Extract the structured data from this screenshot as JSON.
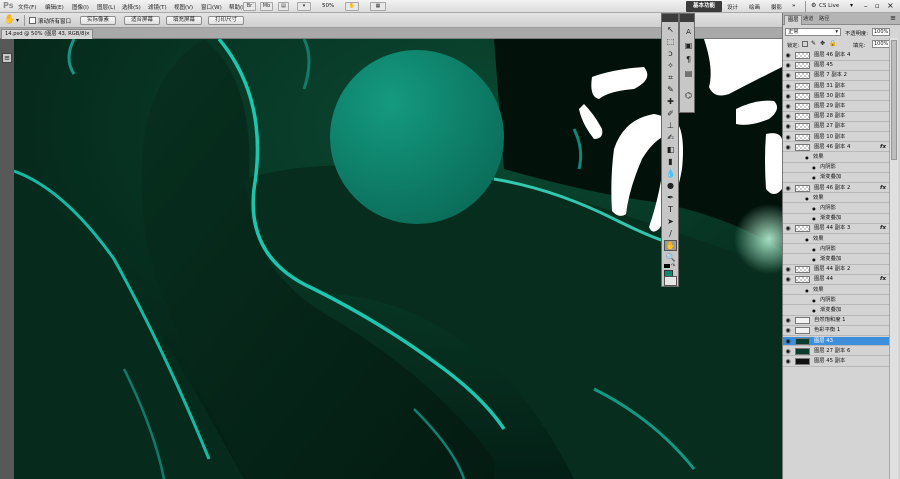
{
  "app": {
    "logo": "Ps",
    "menus": [
      "文件(F)",
      "编辑(E)",
      "图像(I)",
      "图层(L)",
      "选择(S)",
      "滤镜(T)",
      "视图(V)",
      "窗口(W)",
      "帮助(H)"
    ],
    "zoom": "50%",
    "workspaces": [
      "基本功能",
      "设计",
      "绘画",
      "摄影",
      "CS Live"
    ],
    "workspace_more": "»"
  },
  "options": {
    "checkbox_label": "滚动所有窗口",
    "buttons": [
      "实际像素",
      "适合屏幕",
      "填充屏幕",
      "打印尺寸"
    ]
  },
  "document": {
    "tab_title": "14.psd @ 50% (图层 43, RGB/8)"
  },
  "layers_panel": {
    "tabs": [
      "图层",
      "通道",
      "路径"
    ],
    "blend_mode": "正常",
    "opacity_label": "不透明度:",
    "opacity_value": "100%",
    "lock_label": "锁定:",
    "fill_label": "填充:",
    "fill_value": "100%",
    "layers": [
      {
        "name": "图层 46 副本 4",
        "thumb": "chk",
        "fx": false,
        "selected": false
      },
      {
        "name": "图层 45",
        "thumb": "chk",
        "fx": false,
        "selected": false
      },
      {
        "name": "图层 7 副本 2",
        "thumb": "chk",
        "fx": false,
        "selected": false
      },
      {
        "name": "图层 31 副本",
        "thumb": "chk",
        "fx": false,
        "selected": false
      },
      {
        "name": "图层 30 副本",
        "thumb": "chk",
        "fx": false,
        "selected": false
      },
      {
        "name": "图层 29 副本",
        "thumb": "chk",
        "fx": false,
        "selected": false
      },
      {
        "name": "图层 28 副本",
        "thumb": "chk",
        "fx": false,
        "selected": false
      },
      {
        "name": "图层 27 副本",
        "thumb": "chk",
        "fx": false,
        "selected": false
      },
      {
        "name": "图层 10 副本",
        "thumb": "chk",
        "fx": false,
        "selected": false
      },
      {
        "name": "图层 46 副本 4",
        "thumb": "chk",
        "fx": true,
        "selected": false
      },
      {
        "name": "效果",
        "sub": 1
      },
      {
        "name": "内阴影",
        "sub": 2
      },
      {
        "name": "渐变叠加",
        "sub": 2
      },
      {
        "name": "图层 46 副本 2",
        "thumb": "chk",
        "fx": true,
        "selected": false
      },
      {
        "name": "效果",
        "sub": 1
      },
      {
        "name": "内阴影",
        "sub": 2
      },
      {
        "name": "渐变叠加",
        "sub": 2
      },
      {
        "name": "图层 44 副本 3",
        "thumb": "chk",
        "fx": true,
        "selected": false
      },
      {
        "name": "效果",
        "sub": 1
      },
      {
        "name": "内阴影",
        "sub": 2
      },
      {
        "name": "渐变叠加",
        "sub": 2
      },
      {
        "name": "图层 44 副本 2",
        "thumb": "chk",
        "fx": false,
        "selected": false
      },
      {
        "name": "图层 44",
        "thumb": "chk",
        "fx": true,
        "selected": false
      },
      {
        "name": "效果",
        "sub": 1
      },
      {
        "name": "内阴影",
        "sub": 2
      },
      {
        "name": "渐变叠加",
        "sub": 2
      },
      {
        "name": "自然饱和度 1",
        "thumb": "white",
        "fx": false,
        "selected": false
      },
      {
        "name": "色彩平衡 1",
        "thumb": "white",
        "fx": false,
        "selected": false
      },
      {
        "name": "图层 43",
        "thumb": "dark",
        "fx": false,
        "selected": true
      },
      {
        "name": "图层 27 副本 6",
        "thumb": "dark",
        "fx": false,
        "selected": false
      },
      {
        "name": "图层 45 副本",
        "thumb": "black",
        "fx": false,
        "selected": false
      }
    ]
  },
  "colors": {
    "canvas_bg": "#052218",
    "accent_teal": "#19c9b5",
    "circle": "#0f8a72",
    "selection": "#3d8fdc"
  }
}
